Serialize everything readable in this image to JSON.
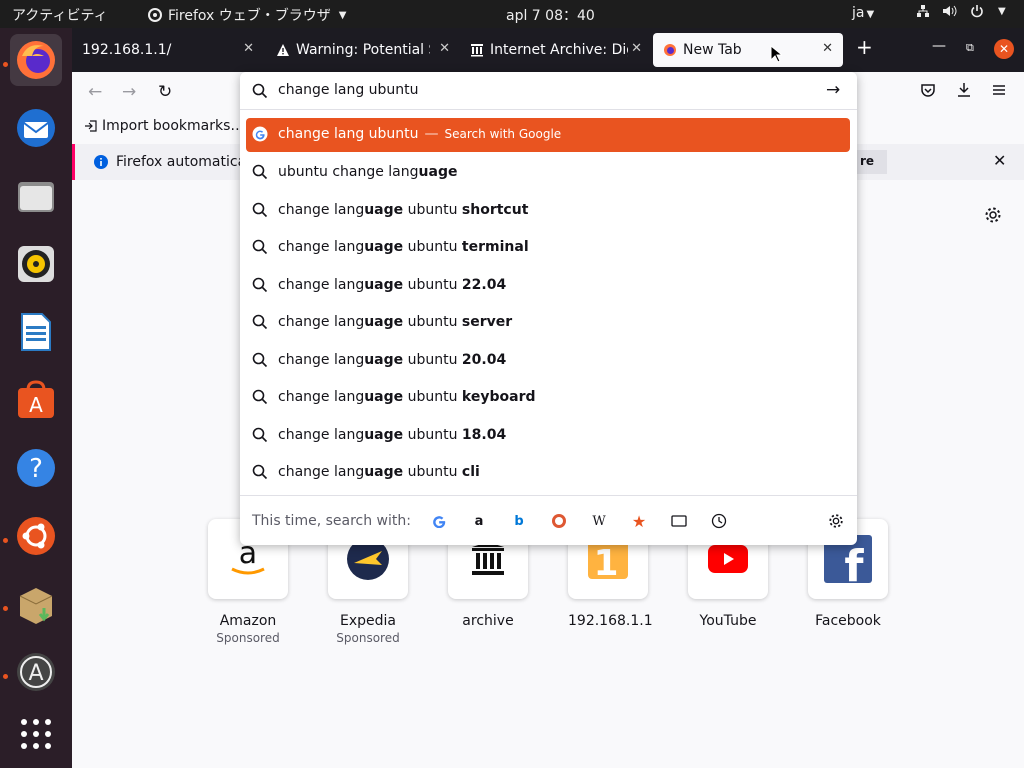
{
  "topbar": {
    "activities": "アクティビティ",
    "app_name": "Firefox ウェブ・ブラウザ",
    "clock": "apl 7  08：40",
    "input_method": "ja"
  },
  "dock": {
    "items": [
      "firefox",
      "thunderbird",
      "files",
      "rhythmbox",
      "libreoffice-writer",
      "ubuntu-software",
      "help",
      "ubuntu",
      "installer",
      "updater",
      "show-applications"
    ]
  },
  "tabs": [
    {
      "title": "192.168.1.1/"
    },
    {
      "title": "Warning: Potential S"
    },
    {
      "title": "Internet Archive: Dig"
    },
    {
      "title": "New Tab"
    }
  ],
  "bookmarks_toolbar": {
    "import_label": "Import bookmarks…"
  },
  "notification": {
    "text": "Firefox automatica",
    "button_fragment": "re"
  },
  "urlbar": {
    "query": "change lang ubuntu",
    "heuristic": {
      "text": "change lang ubuntu",
      "separator": "—",
      "action": "Search with Google"
    },
    "suggestions": [
      {
        "prefix": "ubuntu change lang",
        "bold": "uage"
      },
      {
        "prefix": "change lang",
        "bold": "uage",
        "mid": " ubuntu ",
        "tail": "shortcut"
      },
      {
        "prefix": "change lang",
        "bold": "uage",
        "mid": " ubuntu ",
        "tail": "terminal"
      },
      {
        "prefix": "change lang",
        "bold": "uage",
        "mid": " ubuntu ",
        "tail": "22.04"
      },
      {
        "prefix": "change lang",
        "bold": "uage",
        "mid": " ubuntu ",
        "tail": "server"
      },
      {
        "prefix": "change lang",
        "bold": "uage",
        "mid": " ubuntu ",
        "tail": "20.04"
      },
      {
        "prefix": "change lang",
        "bold": "uage",
        "mid": " ubuntu ",
        "tail": "keyboard"
      },
      {
        "prefix": "change lang",
        "bold": "uage",
        "mid": " ubuntu ",
        "tail": "18.04"
      },
      {
        "prefix": "change lang",
        "bold": "uage",
        "mid": " ubuntu ",
        "tail": "cli"
      }
    ],
    "one_off_label": "This time, search with:",
    "one_off_engines": [
      "google-icon",
      "amazon-icon",
      "bing-icon",
      "duckduckgo-icon",
      "wikipedia-icon",
      "bookmarks-icon",
      "tabs-icon",
      "history-icon",
      "settings-icon"
    ]
  },
  "top_sites": [
    {
      "name": "Amazon",
      "sponsored": "Sponsored"
    },
    {
      "name": "Expedia",
      "sponsored": "Sponsored"
    },
    {
      "name": "archive",
      "sponsored": ""
    },
    {
      "name": "192.168.1.1",
      "sponsored": ""
    },
    {
      "name": "YouTube",
      "sponsored": ""
    },
    {
      "name": "Facebook",
      "sponsored": ""
    }
  ],
  "colors": {
    "accent": "#e95420",
    "tabbar": "#1c1b22",
    "topbar": "#1d1d1d",
    "dock": "#2b1e28"
  }
}
